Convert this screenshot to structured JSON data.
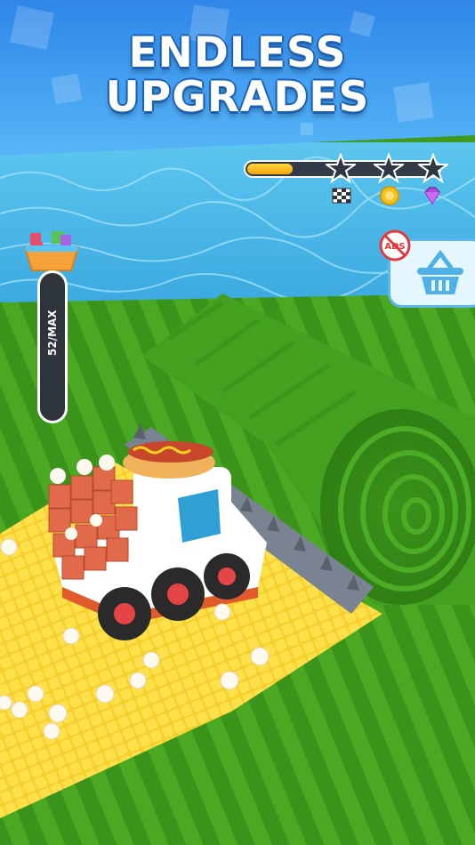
{
  "banner": {
    "line1": "ENDLESS",
    "line2": "UPGRADES"
  },
  "level_progress": {
    "fill_fraction": 0.24,
    "stars_total": 3,
    "stars_earned": 0,
    "reward_icons": [
      "checkered-flag-icon",
      "coin-icon",
      "gem-icon"
    ]
  },
  "capacity": {
    "label": "52/MAX"
  },
  "shop": {
    "icon": "shopping-basket-icon",
    "no_ads_label": "ADS"
  },
  "colors": {
    "banner": "#2f86e8",
    "progress_fill": "#f5b516",
    "grass": "#3f9a1e",
    "corn": "#f6cf2c",
    "water": "#4db8ea"
  }
}
